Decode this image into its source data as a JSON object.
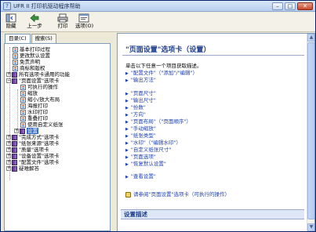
{
  "window": {
    "title": "UFR II 打印机驱动程序帮助"
  },
  "toolbar": {
    "items": [
      {
        "label": "隐藏",
        "icon": "hide-icon"
      },
      {
        "label": "上一步",
        "icon": "back-icon"
      },
      {
        "label": "打印",
        "icon": "print-icon"
      },
      {
        "label": "选项(O)",
        "icon": "options-icon"
      }
    ]
  },
  "tabs": [
    {
      "label": "目录(C)",
      "active": true
    },
    {
      "label": "搜索(S)",
      "active": false
    }
  ],
  "tree": [
    {
      "label": "基本打印过程",
      "icon": "doc"
    },
    {
      "label": "更改默认设置",
      "icon": "doc"
    },
    {
      "label": "免责声明",
      "icon": "doc"
    },
    {
      "label": "商标和版权",
      "icon": "doc"
    },
    {
      "label": "所有选项卡通用的功能",
      "icon": "book",
      "expander": "+"
    },
    {
      "label": "\"页面设置\"选项卡",
      "icon": "book",
      "expander": "-"
    },
    {
      "label": "可执行的操作",
      "icon": "doc"
    },
    {
      "label": "缩放",
      "icon": "doc"
    },
    {
      "label": "缩小/放大布局",
      "icon": "doc"
    },
    {
      "label": "海报打印",
      "icon": "doc"
    },
    {
      "label": "水印打印",
      "icon": "doc"
    },
    {
      "label": "重叠打印",
      "icon": "doc"
    },
    {
      "label": "使用自定义纸张",
      "icon": "doc"
    },
    {
      "label": "设置",
      "icon": "book",
      "expander": "+",
      "selected": true
    },
    {
      "label": "\"完成方式\"选项卡",
      "icon": "book",
      "expander": "+"
    },
    {
      "label": "\"纸张来源\"选项卡",
      "icon": "book",
      "expander": "+"
    },
    {
      "label": "\"质量\"选项卡",
      "icon": "book",
      "expander": "+"
    },
    {
      "label": "\"设备设置\"选项卡",
      "icon": "book",
      "expander": "+"
    },
    {
      "label": "\"配置文件\"选项卡",
      "icon": "book",
      "expander": "+"
    },
    {
      "label": "疑难解答",
      "icon": "book",
      "expander": "+"
    }
  ],
  "content": {
    "title": "\"页面设置\"选项卡（设置）",
    "intro": "单击以下任意一个项目获取描述。",
    "group1": [
      "\"配置文件\"（\"添加\"/\"编辑\"）",
      "\"输出方法\""
    ],
    "group2": [
      "\"页面尺寸\"",
      "\"输出尺寸\"",
      "\"份数\"",
      "\"方向\"",
      "\"页面布局\"（\"页面顺序\"）",
      "\"手动缩放\"",
      "\"纸张类型\"",
      "\"水印\"（\"编辑水印\"）",
      "\"自定义纸张尺寸\"",
      "\"页面选项\"",
      "\"恢复默认设置\""
    ],
    "group3": [
      "\"查看设置\""
    ],
    "note": "请参阅\"页面设置\"选项卡（可执行的操作）",
    "section_header": "设置描述"
  },
  "colors": {
    "link": "#1c3fb0",
    "title": "#1f3f8f",
    "selection": "#316ac5"
  }
}
